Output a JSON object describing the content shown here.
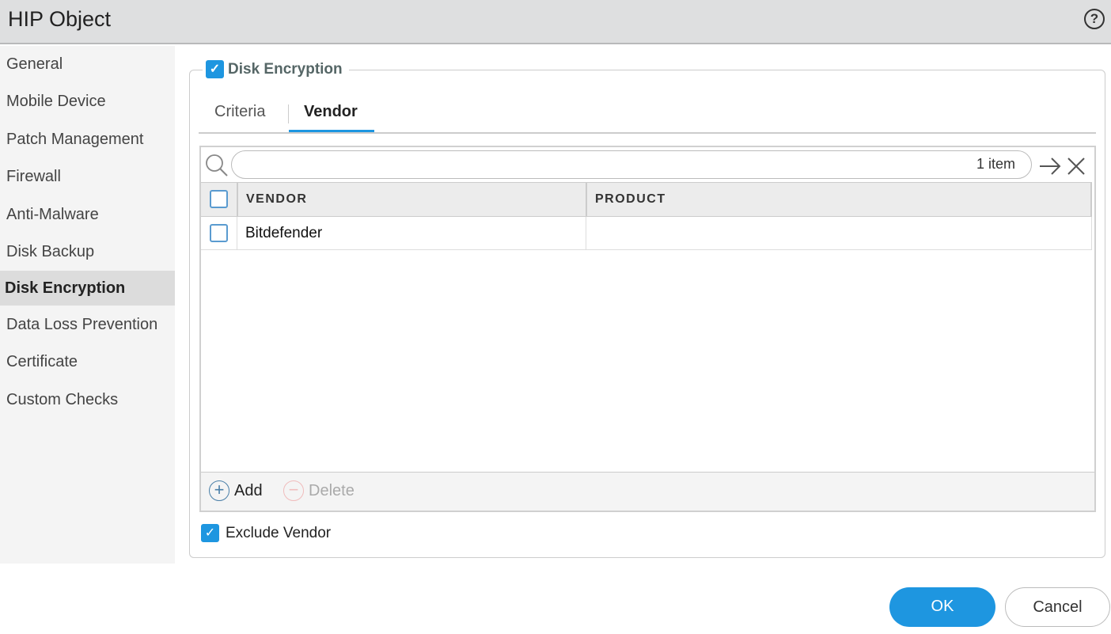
{
  "header": {
    "title": "HIP Object",
    "help_icon": "?"
  },
  "sidebar": {
    "items": [
      {
        "label": "General"
      },
      {
        "label": "Mobile Device"
      },
      {
        "label": "Patch Management"
      },
      {
        "label": "Firewall"
      },
      {
        "label": "Anti-Malware"
      },
      {
        "label": "Disk Backup"
      },
      {
        "label": "Disk Encryption",
        "active": true
      },
      {
        "label": "Data Loss Prevention"
      },
      {
        "label": "Certificate"
      },
      {
        "label": "Custom Checks"
      }
    ]
  },
  "section": {
    "label": "Disk Encryption",
    "checked": true
  },
  "tabs": [
    {
      "label": "Criteria"
    },
    {
      "label": "Vendor",
      "active": true
    }
  ],
  "search": {
    "value": "",
    "count": "1 item"
  },
  "table": {
    "columns": [
      "VENDOR",
      "PRODUCT"
    ],
    "rows": [
      {
        "vendor": "Bitdefender",
        "product": ""
      }
    ]
  },
  "footer": {
    "add": "Add",
    "delete": "Delete"
  },
  "exclude_vendor": {
    "label": "Exclude Vendor",
    "checked": true
  },
  "buttons": {
    "ok": "OK",
    "cancel": "Cancel"
  },
  "colors": {
    "accent": "#1e96e0"
  }
}
